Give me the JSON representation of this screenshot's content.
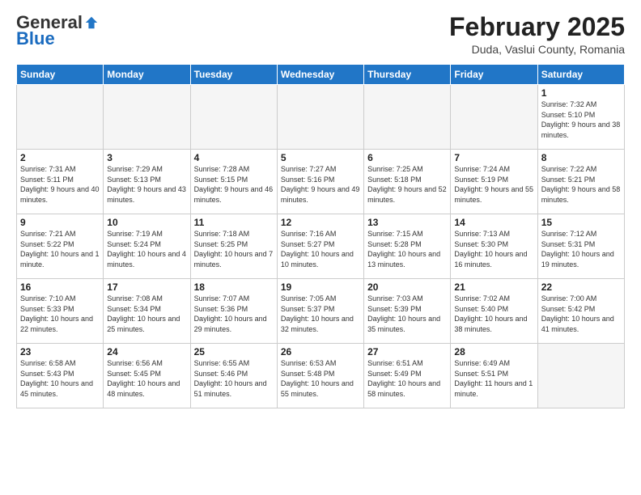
{
  "header": {
    "logo_general": "General",
    "logo_blue": "Blue",
    "month_title": "February 2025",
    "subtitle": "Duda, Vaslui County, Romania"
  },
  "weekdays": [
    "Sunday",
    "Monday",
    "Tuesday",
    "Wednesday",
    "Thursday",
    "Friday",
    "Saturday"
  ],
  "weeks": [
    [
      {
        "day": "",
        "info": ""
      },
      {
        "day": "",
        "info": ""
      },
      {
        "day": "",
        "info": ""
      },
      {
        "day": "",
        "info": ""
      },
      {
        "day": "",
        "info": ""
      },
      {
        "day": "",
        "info": ""
      },
      {
        "day": "1",
        "info": "Sunrise: 7:32 AM\nSunset: 5:10 PM\nDaylight: 9 hours and 38 minutes."
      }
    ],
    [
      {
        "day": "2",
        "info": "Sunrise: 7:31 AM\nSunset: 5:11 PM\nDaylight: 9 hours and 40 minutes."
      },
      {
        "day": "3",
        "info": "Sunrise: 7:29 AM\nSunset: 5:13 PM\nDaylight: 9 hours and 43 minutes."
      },
      {
        "day": "4",
        "info": "Sunrise: 7:28 AM\nSunset: 5:15 PM\nDaylight: 9 hours and 46 minutes."
      },
      {
        "day": "5",
        "info": "Sunrise: 7:27 AM\nSunset: 5:16 PM\nDaylight: 9 hours and 49 minutes."
      },
      {
        "day": "6",
        "info": "Sunrise: 7:25 AM\nSunset: 5:18 PM\nDaylight: 9 hours and 52 minutes."
      },
      {
        "day": "7",
        "info": "Sunrise: 7:24 AM\nSunset: 5:19 PM\nDaylight: 9 hours and 55 minutes."
      },
      {
        "day": "8",
        "info": "Sunrise: 7:22 AM\nSunset: 5:21 PM\nDaylight: 9 hours and 58 minutes."
      }
    ],
    [
      {
        "day": "9",
        "info": "Sunrise: 7:21 AM\nSunset: 5:22 PM\nDaylight: 10 hours and 1 minute."
      },
      {
        "day": "10",
        "info": "Sunrise: 7:19 AM\nSunset: 5:24 PM\nDaylight: 10 hours and 4 minutes."
      },
      {
        "day": "11",
        "info": "Sunrise: 7:18 AM\nSunset: 5:25 PM\nDaylight: 10 hours and 7 minutes."
      },
      {
        "day": "12",
        "info": "Sunrise: 7:16 AM\nSunset: 5:27 PM\nDaylight: 10 hours and 10 minutes."
      },
      {
        "day": "13",
        "info": "Sunrise: 7:15 AM\nSunset: 5:28 PM\nDaylight: 10 hours and 13 minutes."
      },
      {
        "day": "14",
        "info": "Sunrise: 7:13 AM\nSunset: 5:30 PM\nDaylight: 10 hours and 16 minutes."
      },
      {
        "day": "15",
        "info": "Sunrise: 7:12 AM\nSunset: 5:31 PM\nDaylight: 10 hours and 19 minutes."
      }
    ],
    [
      {
        "day": "16",
        "info": "Sunrise: 7:10 AM\nSunset: 5:33 PM\nDaylight: 10 hours and 22 minutes."
      },
      {
        "day": "17",
        "info": "Sunrise: 7:08 AM\nSunset: 5:34 PM\nDaylight: 10 hours and 25 minutes."
      },
      {
        "day": "18",
        "info": "Sunrise: 7:07 AM\nSunset: 5:36 PM\nDaylight: 10 hours and 29 minutes."
      },
      {
        "day": "19",
        "info": "Sunrise: 7:05 AM\nSunset: 5:37 PM\nDaylight: 10 hours and 32 minutes."
      },
      {
        "day": "20",
        "info": "Sunrise: 7:03 AM\nSunset: 5:39 PM\nDaylight: 10 hours and 35 minutes."
      },
      {
        "day": "21",
        "info": "Sunrise: 7:02 AM\nSunset: 5:40 PM\nDaylight: 10 hours and 38 minutes."
      },
      {
        "day": "22",
        "info": "Sunrise: 7:00 AM\nSunset: 5:42 PM\nDaylight: 10 hours and 41 minutes."
      }
    ],
    [
      {
        "day": "23",
        "info": "Sunrise: 6:58 AM\nSunset: 5:43 PM\nDaylight: 10 hours and 45 minutes."
      },
      {
        "day": "24",
        "info": "Sunrise: 6:56 AM\nSunset: 5:45 PM\nDaylight: 10 hours and 48 minutes."
      },
      {
        "day": "25",
        "info": "Sunrise: 6:55 AM\nSunset: 5:46 PM\nDaylight: 10 hours and 51 minutes."
      },
      {
        "day": "26",
        "info": "Sunrise: 6:53 AM\nSunset: 5:48 PM\nDaylight: 10 hours and 55 minutes."
      },
      {
        "day": "27",
        "info": "Sunrise: 6:51 AM\nSunset: 5:49 PM\nDaylight: 10 hours and 58 minutes."
      },
      {
        "day": "28",
        "info": "Sunrise: 6:49 AM\nSunset: 5:51 PM\nDaylight: 11 hours and 1 minute."
      },
      {
        "day": "",
        "info": ""
      }
    ]
  ]
}
